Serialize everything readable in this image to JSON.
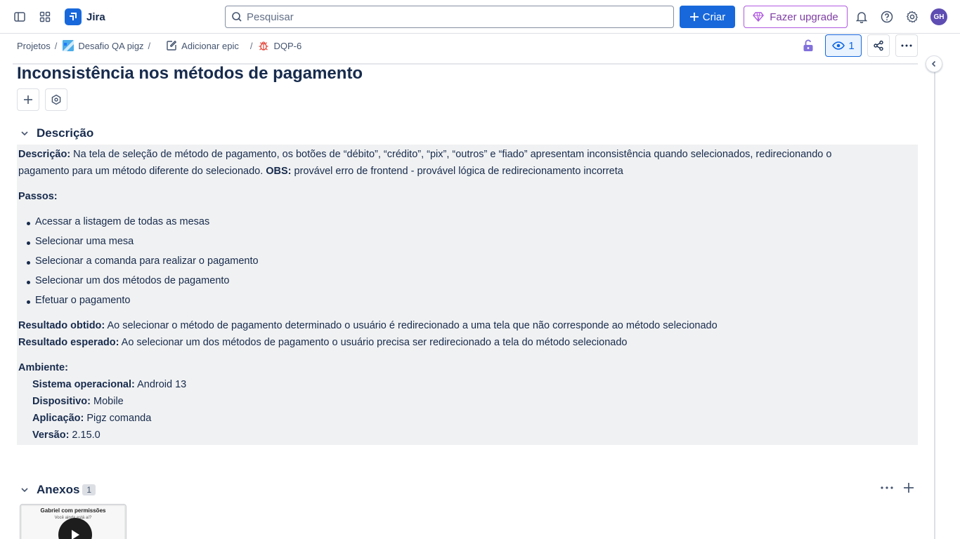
{
  "nav": {
    "app_name": "Jira",
    "search_placeholder": "Pesquisar",
    "create_label": "Criar",
    "upgrade_label": "Fazer upgrade",
    "avatar_initials": "GH"
  },
  "breadcrumb": {
    "items": [
      {
        "label": "Projetos",
        "sep": "/"
      },
      {
        "label": "Desafio QA pigz",
        "sep": "/"
      },
      {
        "label": "Adicionar epic",
        "sep": "/"
      },
      {
        "label": "DQP-6"
      }
    ]
  },
  "actions": {
    "watchers_count": "1"
  },
  "issue": {
    "title": "Inconsistência nos métodos de pagamento"
  },
  "description": {
    "section_title": "Descrição",
    "intro_label": "Descrição:",
    "intro_text_1": " Na tela de seleção de método de pagamento, os botões de “débito”, “crédito”, “pix”, “outros” e “fiado” apresentam inconsistência quando selecionados, redirecionando o",
    "intro_text_2": "pagamento para um método diferente do selecionado. ",
    "obs_label": "OBS:",
    "obs_text": " provável erro de frontend - provável lógica de redirecionamento incorreta",
    "steps_label": "Passos:",
    "steps": [
      "Acessar a listagem de todas as mesas",
      "Selecionar uma mesa",
      "Selecionar a comanda para realizar o pagamento",
      "Selecionar um dos métodos de pagamento",
      "Efetuar o pagamento"
    ],
    "obtained_label": "Resultado obtido:",
    "obtained_text": " Ao selecionar o método de pagamento determinado o usuário é redirecionado a uma tela que não corresponde ao método selecionado",
    "expected_label": "Resultado esperado:",
    "expected_text": " Ao selecionar um dos métodos de pagamento o usuário precisa ser redirecionado a tela do método selecionado",
    "env_label": "Ambiente:",
    "env": [
      {
        "label": "Sistema operacional:",
        "value": " Android 13"
      },
      {
        "label": "Dispositivo:",
        "value": " Mobile"
      },
      {
        "label": "Aplicação:",
        "value": " Pigz comanda"
      },
      {
        "label": "Versão:",
        "value": " 2.15.0"
      }
    ]
  },
  "attachments": {
    "section_title": "Anexos",
    "count": "1",
    "thumb_title": "Gabriel com permissões",
    "thumb_subtitle": "Você ainda está aí?"
  }
}
